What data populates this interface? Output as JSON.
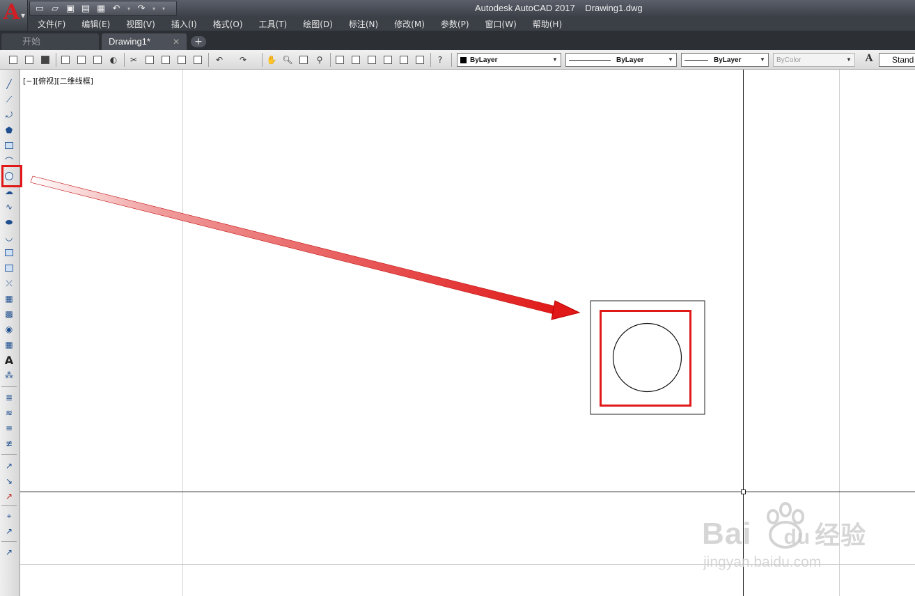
{
  "window": {
    "app_title": "Autodesk AutoCAD 2017",
    "file_name": "Drawing1.dwg"
  },
  "menu": [
    "文件(F)",
    "编辑(E)",
    "视图(V)",
    "插入(I)",
    "格式(O)",
    "工具(T)",
    "绘图(D)",
    "标注(N)",
    "修改(M)",
    "参数(P)",
    "窗口(W)",
    "帮助(H)"
  ],
  "tabs": {
    "start_label": "开始",
    "drawing_label": "Drawing1*",
    "close_symbol": "✕",
    "add_symbol": "+"
  },
  "properties": {
    "color": "ByLayer",
    "linetype": "ByLayer",
    "lineweight": "ByLayer",
    "plotstyle": "ByColor",
    "text_style": "Stand"
  },
  "viewport": {
    "label": "[−][俯视][二维线框]"
  },
  "annotation": {
    "highlight_color": "#e01818"
  },
  "watermark": {
    "brand": "Bai",
    "brand_tail": "du",
    "brand_cn": "经验",
    "url": "jingyan.baidu.com"
  },
  "icons": {
    "left_toolbar": [
      "line-icon",
      "construction-line-icon",
      "polyline-icon",
      "polygon-icon",
      "rectangle-icon",
      "arc-icon",
      "circle-icon",
      "revision-cloud-icon",
      "spline-icon",
      "ellipse-icon",
      "ellipse-arc-icon",
      "insert-block-icon",
      "make-block-icon",
      "point-icon",
      "hatch-icon",
      "gradient-icon",
      "region-icon",
      "table-icon",
      "multiline-text-icon",
      "add-selected-icon"
    ]
  }
}
